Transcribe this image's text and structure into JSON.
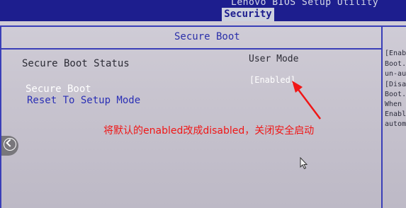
{
  "header": {
    "title": "Lenovo BIOS Setup Utility",
    "active_tab": "Security"
  },
  "panel": {
    "title": "Secure Boot"
  },
  "settings": {
    "secure_boot_status": {
      "label": "Secure Boot Status",
      "value": "User Mode"
    },
    "secure_boot": {
      "label": "Secure Boot",
      "value": "[Enabled]"
    },
    "reset_to_setup_mode": {
      "label": "Reset To Setup Mode"
    }
  },
  "help": {
    "lines": [
      "[Enab",
      "Boot.",
      "un-au",
      "[Disa",
      "Boot.",
      "When S",
      "Enable",
      "automa"
    ]
  },
  "annotation": {
    "text": "将默认的enabled改成disabled，关闭安全启动",
    "color": "#f01616"
  },
  "colors": {
    "bios_blue": "#1d1e8e",
    "highlight_white": "#ffffff",
    "link_blue": "#2a2fb5"
  },
  "icons": {
    "back": "chevron-left-circle-icon",
    "cursor": "mouse-pointer-icon",
    "arrow": "red-annotation-arrow"
  }
}
